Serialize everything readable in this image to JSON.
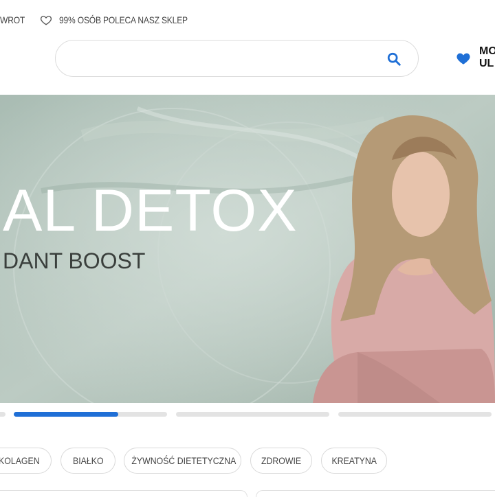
{
  "topbar": {
    "left_text": "WROT",
    "recommend_text": "99% OSÓB POLECA NASZ SKLEP",
    "heart_icon": "heart-outline-icon"
  },
  "search": {
    "value": "",
    "placeholder": "",
    "icon": "search-icon"
  },
  "wishlist": {
    "label": "MO\nUL",
    "icon": "heart-icon",
    "color": "#1f6fd6"
  },
  "banner": {
    "title": "AL DETOX",
    "subtitle": "DANT BOOST"
  },
  "carousel": {
    "active_index": 1,
    "active_progress": 0.68,
    "accent": "#1f6fd6"
  },
  "categories": [
    {
      "label": "KOLAGEN"
    },
    {
      "label": "BIAŁKO"
    },
    {
      "label": "ŻYWNOŚĆ DIETETYCZNA"
    },
    {
      "label": "ZDROWIE"
    },
    {
      "label": "KREATYNA"
    }
  ]
}
